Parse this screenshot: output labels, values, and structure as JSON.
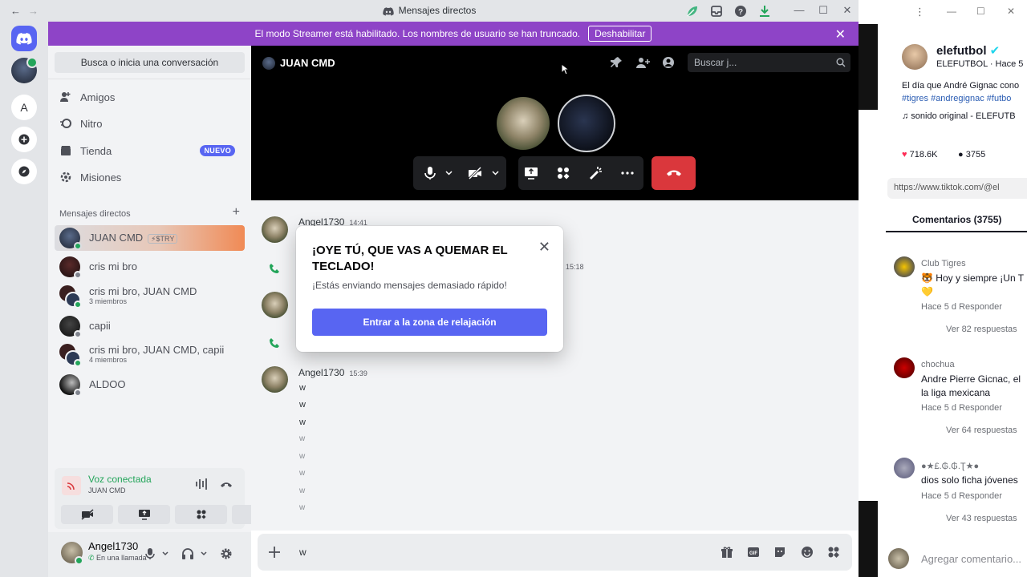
{
  "window": {
    "title": "Mensajes directos",
    "back": "←",
    "forward": "→",
    "minimize": "—",
    "maximize": "☐",
    "close": "✕"
  },
  "streamer_banner": {
    "text": "El modo Streamer está habilitado. Los nombres de usuario se han truncado.",
    "disable_label": "Deshabilitar",
    "close": "✕"
  },
  "guilds": {
    "letter_server": "A"
  },
  "sidebar": {
    "search_label": "Busca o inicia una conversación",
    "nav": [
      "Amigos",
      "Nitro",
      "Tienda",
      "Misiones"
    ],
    "new_badge": "NUEVO",
    "dm_header": "Mensajes directos",
    "dm_add": "+",
    "dms": [
      {
        "name": "JUAN CMD",
        "tag": "⚡$TRY",
        "sub": "",
        "online": true
      },
      {
        "name": "cris mi bro",
        "sub": "",
        "online": false
      },
      {
        "name": "cris mi bro, JUAN CMD",
        "sub": "3 miembros",
        "online": true
      },
      {
        "name": "capii",
        "sub": "",
        "online": false
      },
      {
        "name": "cris mi bro, JUAN CMD, capii",
        "sub": "4 miembros",
        "online": true
      },
      {
        "name": "ALDOO",
        "sub": "",
        "online": false
      }
    ]
  },
  "voice": {
    "status": "Voz conectada",
    "channel": "JUAN CMD"
  },
  "user": {
    "name": "Angel1730",
    "status": "En una llamada"
  },
  "call": {
    "name": "JUAN CMD",
    "search_placeholder": "Buscar j..."
  },
  "messages": {
    "author": "Angel1730",
    "time1": "14:41",
    "time2": "15:18",
    "call_log_tail": "o.",
    "time3": "15:39",
    "lines": [
      "w",
      "w",
      "w",
      "w",
      "w",
      "w",
      "w",
      "w"
    ]
  },
  "composer": {
    "value": "w"
  },
  "modal": {
    "title": "¡OYE TÚ, QUE VAS A QUEMAR EL TECLADO!",
    "subtitle": "¡Estás enviando mensajes demasiado rápido!",
    "button": "Entrar a la zona de relajación",
    "close": "✕"
  },
  "tiktok": {
    "account": "elefutbol",
    "handle": "ELEFUTBOL · Hace 5",
    "caption": "El día que André Gignac cono",
    "hashtags": "#tigres #andregignac #futbo",
    "sound": "♫  sonido original - ELEFUTB",
    "likes": "718.6K",
    "comments_count": "3755",
    "link": "https://www.tiktok.com/@el",
    "comments_header": "Comentarios (3755)",
    "comments": [
      {
        "user": "Club Tigres",
        "text": "🐯 Hoy y siempre ¡Un T",
        "text2": "💛",
        "meta": "Hace 5 d   Responder",
        "replies": "Ver 82 respuestas"
      },
      {
        "user": "chochua",
        "text": "Andre Pierre Gicnac, el",
        "text2": "la liga mexicana",
        "meta": "Hace 5 d   Responder",
        "replies": "Ver 64 respuestas"
      },
      {
        "user": "●★£.₲.₲.Ʈ★●",
        "text": "dios solo ficha jóvenes",
        "text2": "",
        "meta": "Hace 5 d   Responder",
        "replies": "Ver 43 respuestas"
      }
    ],
    "add_comment": "Agregar comentario..."
  },
  "colors": {
    "blurple": "#5865f2",
    "streamer": "#8e44c7",
    "online": "#23a55a",
    "danger": "#da373c"
  }
}
